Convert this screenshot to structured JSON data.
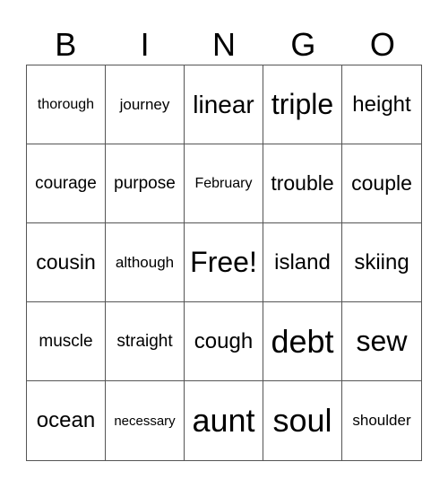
{
  "header": {
    "letters": [
      "B",
      "I",
      "N",
      "G",
      "O"
    ]
  },
  "grid": {
    "rows": [
      [
        "thorough",
        "journey",
        "linear",
        "triple",
        "height"
      ],
      [
        "courage",
        "purpose",
        "February",
        "trouble",
        "couple"
      ],
      [
        "cousin",
        "although",
        "Free!",
        "island",
        "skiing"
      ],
      [
        "muscle",
        "straight",
        "cough",
        "debt",
        "sew"
      ],
      [
        "ocean",
        "necessary",
        "aunt",
        "soul",
        "shoulder"
      ]
    ]
  }
}
